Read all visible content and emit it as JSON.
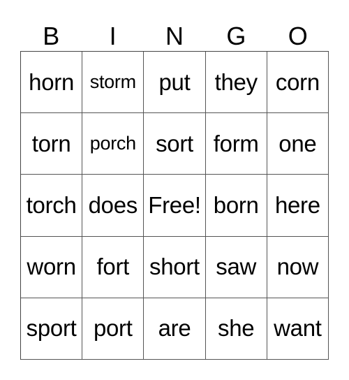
{
  "header": [
    "B",
    "I",
    "N",
    "G",
    "O"
  ],
  "rows": [
    [
      "horn",
      "storm",
      "put",
      "they",
      "corn"
    ],
    [
      "torn",
      "porch",
      "sort",
      "form",
      "one"
    ],
    [
      "torch",
      "does",
      "Free!",
      "born",
      "here"
    ],
    [
      "worn",
      "fort",
      "short",
      "saw",
      "now"
    ],
    [
      "sport",
      "port",
      "are",
      "she",
      "want"
    ]
  ]
}
